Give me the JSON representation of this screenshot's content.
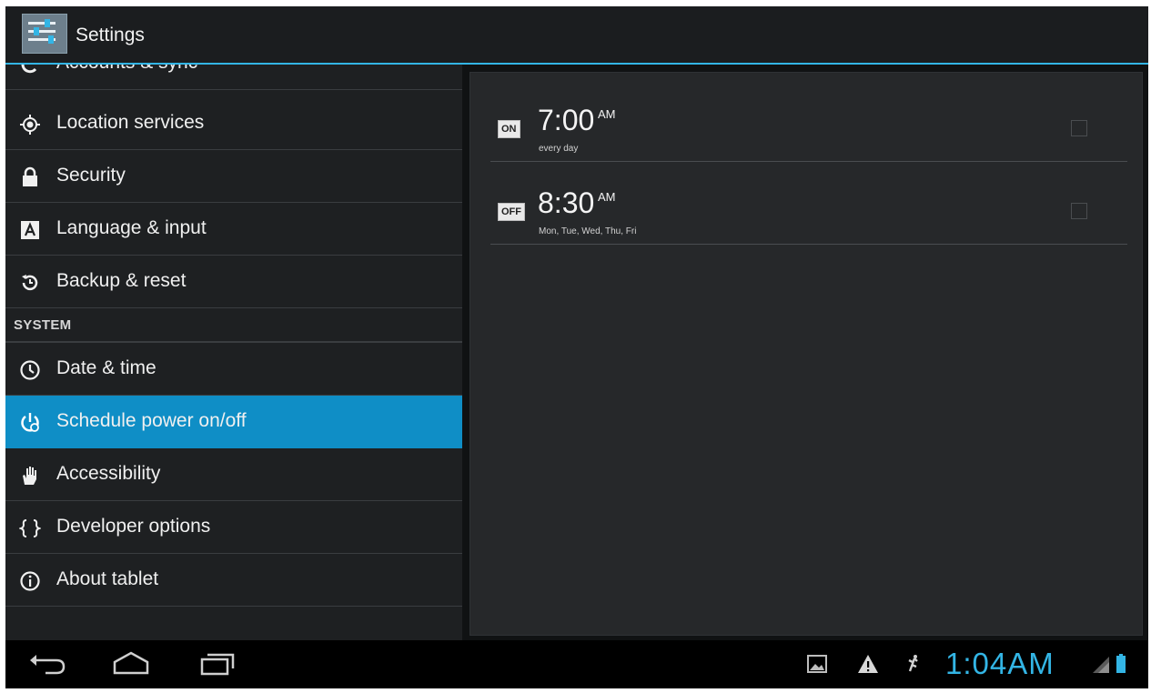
{
  "action_bar": {
    "title": "Settings",
    "icon": "settings-app-icon"
  },
  "sidebar": {
    "items": [
      {
        "label": "Accounts & sync",
        "icon": "sync-icon"
      },
      {
        "label": "Location services",
        "icon": "location-icon"
      },
      {
        "label": "Security",
        "icon": "lock-icon"
      },
      {
        "label": "Language & input",
        "icon": "language-icon"
      },
      {
        "label": "Backup & reset",
        "icon": "backup-reset-icon"
      }
    ],
    "section_system": "SYSTEM",
    "system_items": [
      {
        "label": "Date & time",
        "icon": "clock-icon"
      },
      {
        "label": "Schedule power on/off",
        "icon": "schedule-power-icon",
        "selected": true
      },
      {
        "label": "Accessibility",
        "icon": "hand-icon"
      },
      {
        "label": "Developer options",
        "icon": "braces-icon"
      },
      {
        "label": "About tablet",
        "icon": "info-icon"
      }
    ]
  },
  "schedules": [
    {
      "state": "ON",
      "time": "7:00",
      "ampm": "AM",
      "repeat": "every day",
      "checked": false
    },
    {
      "state": "OFF",
      "time": "8:30",
      "ampm": "AM",
      "repeat": "Mon, Tue, Wed, Thu, Fri",
      "checked": false
    }
  ],
  "status_bar": {
    "clock": "1:04AM",
    "icons": [
      "picture-icon",
      "warning-icon",
      "usb-debug-icon",
      "signal-battery-icon"
    ]
  },
  "nav": {
    "buttons": [
      "back-icon",
      "home-icon",
      "recent-apps-icon"
    ]
  },
  "colors": {
    "accent": "#33b5e5",
    "selected": "#0f8ec6"
  }
}
